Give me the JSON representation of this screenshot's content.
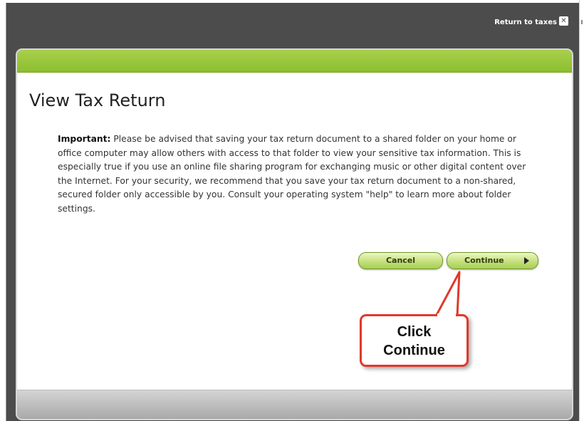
{
  "header": {
    "return_link": "Return to taxes",
    "close_glyph": "✕"
  },
  "dialog": {
    "title": "View Tax Return",
    "body_strong": "Important:",
    "body_text": " Please be advised that saving your tax return document to a shared folder on your home or office computer may allow others with access to that folder to view your sensitive tax information. This is especially true if you use an online file sharing program for exchanging music or other digital content over the Internet. For your security, we recommend that you save your tax return document to a non-shared, secured folder only accessible by you. Consult your operating system \"help\" to learn more about folder settings.",
    "cancel_label": "Cancel",
    "continue_label": "Continue"
  },
  "callout": {
    "line1": "Click",
    "line2": "Continue"
  },
  "colors": {
    "frame": "#4c4c4c",
    "green_bar": "#9cc63d",
    "callout_border": "#e0392b"
  }
}
